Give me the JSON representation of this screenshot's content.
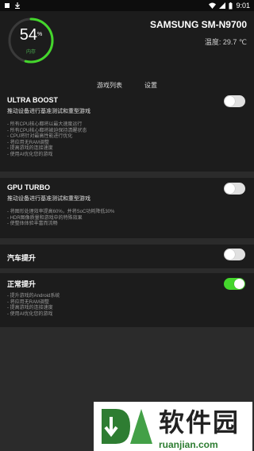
{
  "status_bar": {
    "time": "9:01",
    "left_icons": [
      "notification-icon",
      "download-icon"
    ],
    "right_icons": [
      "wifi-icon",
      "signal-icon",
      "battery-icon"
    ]
  },
  "header": {
    "gauge_value": "54",
    "gauge_unit": "%",
    "gauge_label": "内存",
    "gauge_fraction": 0.54,
    "device_name": "SAMSUNG SM-N9700",
    "temperature": "温度: 29.7 ℃"
  },
  "tabs": [
    {
      "label": "游戏列表",
      "active": false
    },
    {
      "label": "设置",
      "active": true
    }
  ],
  "sections": [
    {
      "title": "ULTRA BOOST",
      "subtitle": "推动设备进行基准测试和重型游戏",
      "items": [
        "- 所有CPU核心都将以最大速度运行",
        "- 所有CPU核心都将被迫保持清醒状态",
        "- CPU将针对最高性能进行优化",
        "- 将应用无RAM调整",
        "- 提高游戏的连接速度",
        "- 使用AI优化您的游戏"
      ],
      "enabled": false
    },
    {
      "title": "GPU TURBO",
      "subtitle": "推动设备进行基准测试和重型游戏",
      "items": [
        "- 将图形处理效率提高60%，并将SoC功耗降低30%",
        "- HDR图像质量和游戏中的特殊效果",
        "- 使整体体验丰富而流畅"
      ],
      "enabled": false
    },
    {
      "title": "汽车提升",
      "subtitle": "",
      "items": [],
      "enabled": false
    },
    {
      "title": "正常提升",
      "subtitle": "",
      "items": [
        "- 提升游戏的Android系统",
        "- 将应用无RAM调整",
        "- 提高游戏的连接速度",
        "- 使用AI优化您的游戏"
      ],
      "enabled": true
    }
  ],
  "watermark": {
    "text_cn": "软件园",
    "text_en": "ruanjian.com"
  },
  "colors": {
    "accent": "#44d62c",
    "background": "#2b2b2b",
    "panel": "#1c1c1c"
  }
}
